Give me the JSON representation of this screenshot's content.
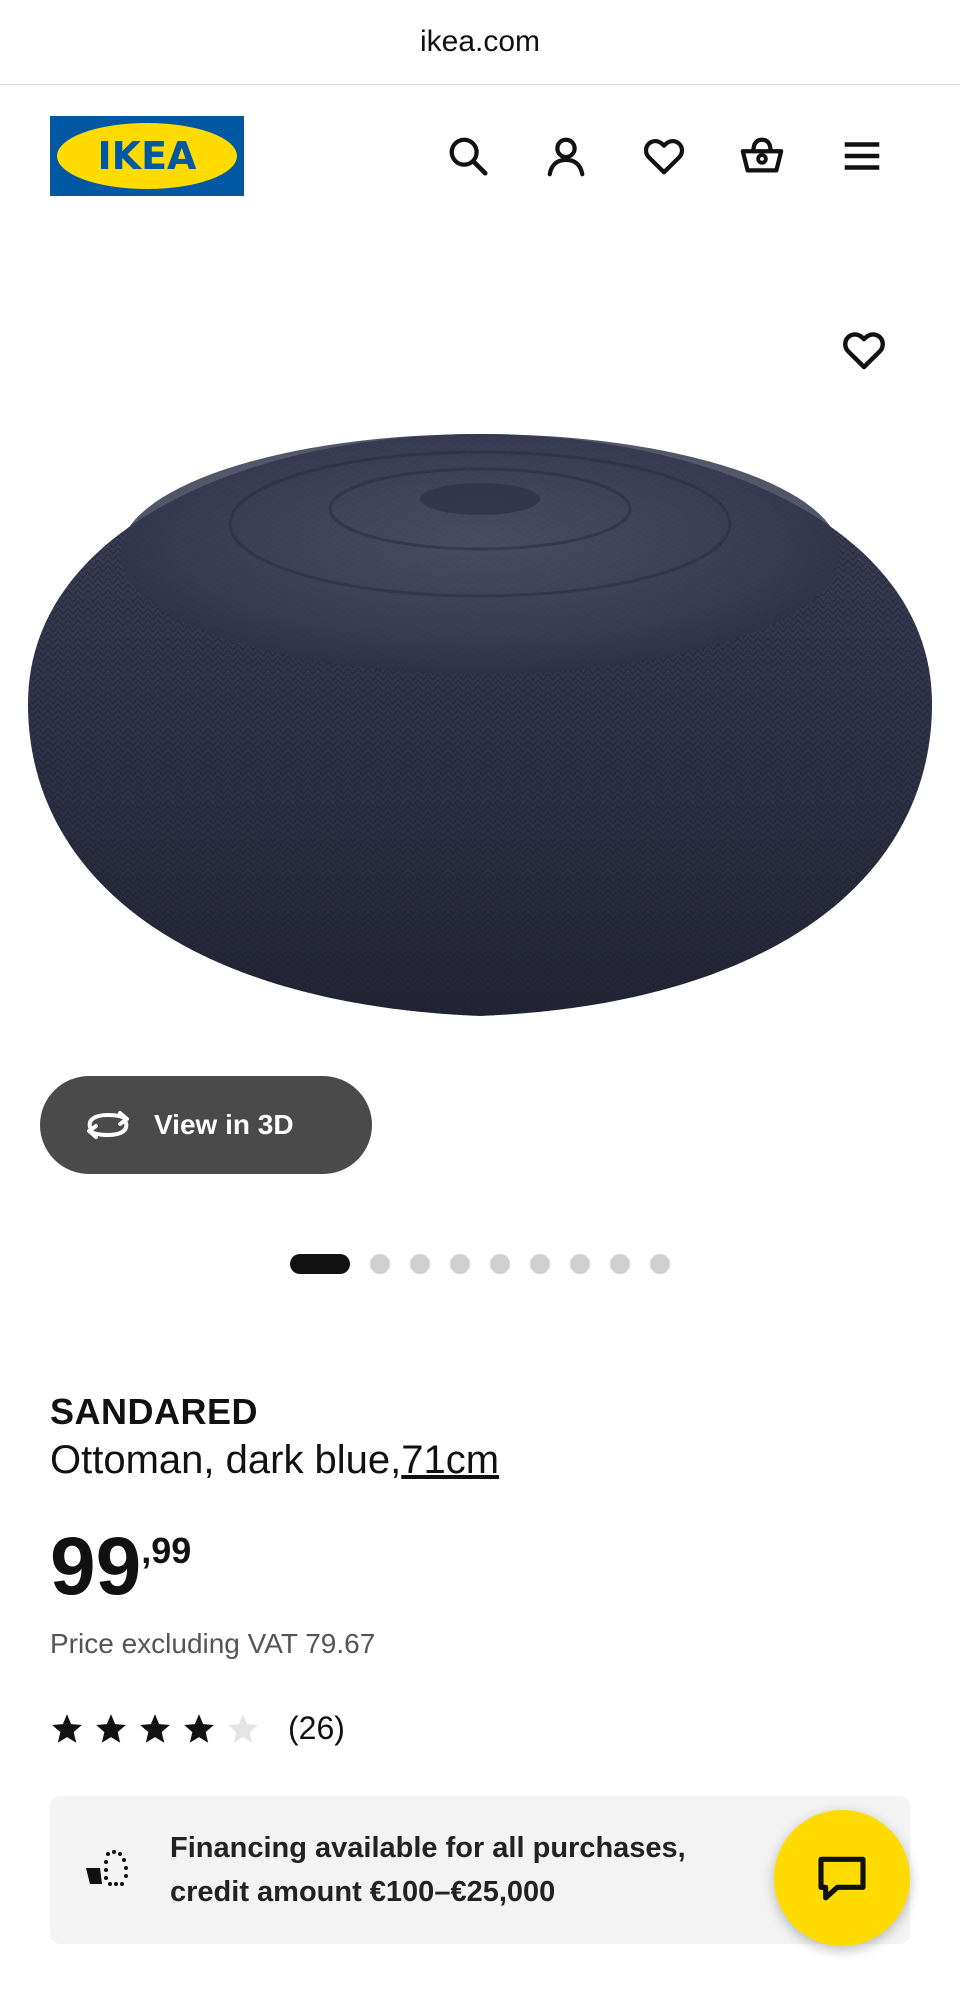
{
  "browser": {
    "url": "ikea.com"
  },
  "header": {
    "logo_text": "IKEA",
    "icons": [
      "search-icon",
      "account-icon",
      "heart-icon",
      "basket-icon",
      "menu-icon"
    ]
  },
  "gallery": {
    "view3d_label": "View in 3D",
    "slide_count": 9,
    "active_slide": 1
  },
  "product": {
    "brand": "SANDARED",
    "description": "Ottoman, dark blue,",
    "size_link": "71cm",
    "price_integer": "99",
    "price_decimal": ",99",
    "price_excl_vat": "Price excluding VAT 79.67",
    "rating_value": 4,
    "rating_max": 5,
    "rating_count": "(26)"
  },
  "finance": {
    "line1": "Financing available for all purchases,",
    "line2": "credit amount €100–€25,000"
  },
  "colors": {
    "ikea_blue": "#0058a3",
    "ikea_yellow": "#ffdb00",
    "view3d_bg": "#4a4a4a",
    "finance_bg": "#f3f3f3"
  }
}
